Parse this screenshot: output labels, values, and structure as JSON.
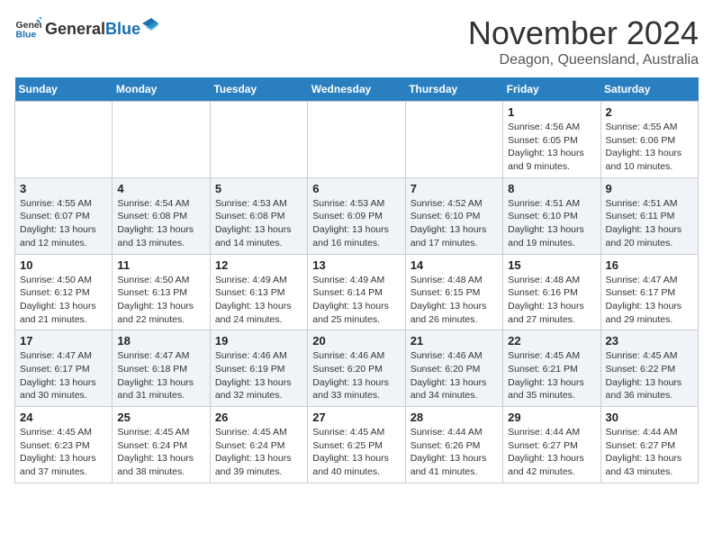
{
  "logo": {
    "general": "General",
    "blue": "Blue"
  },
  "header": {
    "month": "November 2024",
    "location": "Deagon, Queensland, Australia"
  },
  "weekdays": [
    "Sunday",
    "Monday",
    "Tuesday",
    "Wednesday",
    "Thursday",
    "Friday",
    "Saturday"
  ],
  "weeks": [
    {
      "rowClass": "row-normal",
      "days": [
        {
          "date": "",
          "info": ""
        },
        {
          "date": "",
          "info": ""
        },
        {
          "date": "",
          "info": ""
        },
        {
          "date": "",
          "info": ""
        },
        {
          "date": "",
          "info": ""
        },
        {
          "date": "1",
          "info": "Sunrise: 4:56 AM\nSunset: 6:05 PM\nDaylight: 13 hours\nand 9 minutes."
        },
        {
          "date": "2",
          "info": "Sunrise: 4:55 AM\nSunset: 6:06 PM\nDaylight: 13 hours\nand 10 minutes."
        }
      ]
    },
    {
      "rowClass": "row-alt",
      "days": [
        {
          "date": "3",
          "info": "Sunrise: 4:55 AM\nSunset: 6:07 PM\nDaylight: 13 hours\nand 12 minutes."
        },
        {
          "date": "4",
          "info": "Sunrise: 4:54 AM\nSunset: 6:08 PM\nDaylight: 13 hours\nand 13 minutes."
        },
        {
          "date": "5",
          "info": "Sunrise: 4:53 AM\nSunset: 6:08 PM\nDaylight: 13 hours\nand 14 minutes."
        },
        {
          "date": "6",
          "info": "Sunrise: 4:53 AM\nSunset: 6:09 PM\nDaylight: 13 hours\nand 16 minutes."
        },
        {
          "date": "7",
          "info": "Sunrise: 4:52 AM\nSunset: 6:10 PM\nDaylight: 13 hours\nand 17 minutes."
        },
        {
          "date": "8",
          "info": "Sunrise: 4:51 AM\nSunset: 6:10 PM\nDaylight: 13 hours\nand 19 minutes."
        },
        {
          "date": "9",
          "info": "Sunrise: 4:51 AM\nSunset: 6:11 PM\nDaylight: 13 hours\nand 20 minutes."
        }
      ]
    },
    {
      "rowClass": "row-normal",
      "days": [
        {
          "date": "10",
          "info": "Sunrise: 4:50 AM\nSunset: 6:12 PM\nDaylight: 13 hours\nand 21 minutes."
        },
        {
          "date": "11",
          "info": "Sunrise: 4:50 AM\nSunset: 6:13 PM\nDaylight: 13 hours\nand 22 minutes."
        },
        {
          "date": "12",
          "info": "Sunrise: 4:49 AM\nSunset: 6:13 PM\nDaylight: 13 hours\nand 24 minutes."
        },
        {
          "date": "13",
          "info": "Sunrise: 4:49 AM\nSunset: 6:14 PM\nDaylight: 13 hours\nand 25 minutes."
        },
        {
          "date": "14",
          "info": "Sunrise: 4:48 AM\nSunset: 6:15 PM\nDaylight: 13 hours\nand 26 minutes."
        },
        {
          "date": "15",
          "info": "Sunrise: 4:48 AM\nSunset: 6:16 PM\nDaylight: 13 hours\nand 27 minutes."
        },
        {
          "date": "16",
          "info": "Sunrise: 4:47 AM\nSunset: 6:17 PM\nDaylight: 13 hours\nand 29 minutes."
        }
      ]
    },
    {
      "rowClass": "row-alt",
      "days": [
        {
          "date": "17",
          "info": "Sunrise: 4:47 AM\nSunset: 6:17 PM\nDaylight: 13 hours\nand 30 minutes."
        },
        {
          "date": "18",
          "info": "Sunrise: 4:47 AM\nSunset: 6:18 PM\nDaylight: 13 hours\nand 31 minutes."
        },
        {
          "date": "19",
          "info": "Sunrise: 4:46 AM\nSunset: 6:19 PM\nDaylight: 13 hours\nand 32 minutes."
        },
        {
          "date": "20",
          "info": "Sunrise: 4:46 AM\nSunset: 6:20 PM\nDaylight: 13 hours\nand 33 minutes."
        },
        {
          "date": "21",
          "info": "Sunrise: 4:46 AM\nSunset: 6:20 PM\nDaylight: 13 hours\nand 34 minutes."
        },
        {
          "date": "22",
          "info": "Sunrise: 4:45 AM\nSunset: 6:21 PM\nDaylight: 13 hours\nand 35 minutes."
        },
        {
          "date": "23",
          "info": "Sunrise: 4:45 AM\nSunset: 6:22 PM\nDaylight: 13 hours\nand 36 minutes."
        }
      ]
    },
    {
      "rowClass": "row-normal",
      "days": [
        {
          "date": "24",
          "info": "Sunrise: 4:45 AM\nSunset: 6:23 PM\nDaylight: 13 hours\nand 37 minutes."
        },
        {
          "date": "25",
          "info": "Sunrise: 4:45 AM\nSunset: 6:24 PM\nDaylight: 13 hours\nand 38 minutes."
        },
        {
          "date": "26",
          "info": "Sunrise: 4:45 AM\nSunset: 6:24 PM\nDaylight: 13 hours\nand 39 minutes."
        },
        {
          "date": "27",
          "info": "Sunrise: 4:45 AM\nSunset: 6:25 PM\nDaylight: 13 hours\nand 40 minutes."
        },
        {
          "date": "28",
          "info": "Sunrise: 4:44 AM\nSunset: 6:26 PM\nDaylight: 13 hours\nand 41 minutes."
        },
        {
          "date": "29",
          "info": "Sunrise: 4:44 AM\nSunset: 6:27 PM\nDaylight: 13 hours\nand 42 minutes."
        },
        {
          "date": "30",
          "info": "Sunrise: 4:44 AM\nSunset: 6:27 PM\nDaylight: 13 hours\nand 43 minutes."
        }
      ]
    }
  ]
}
